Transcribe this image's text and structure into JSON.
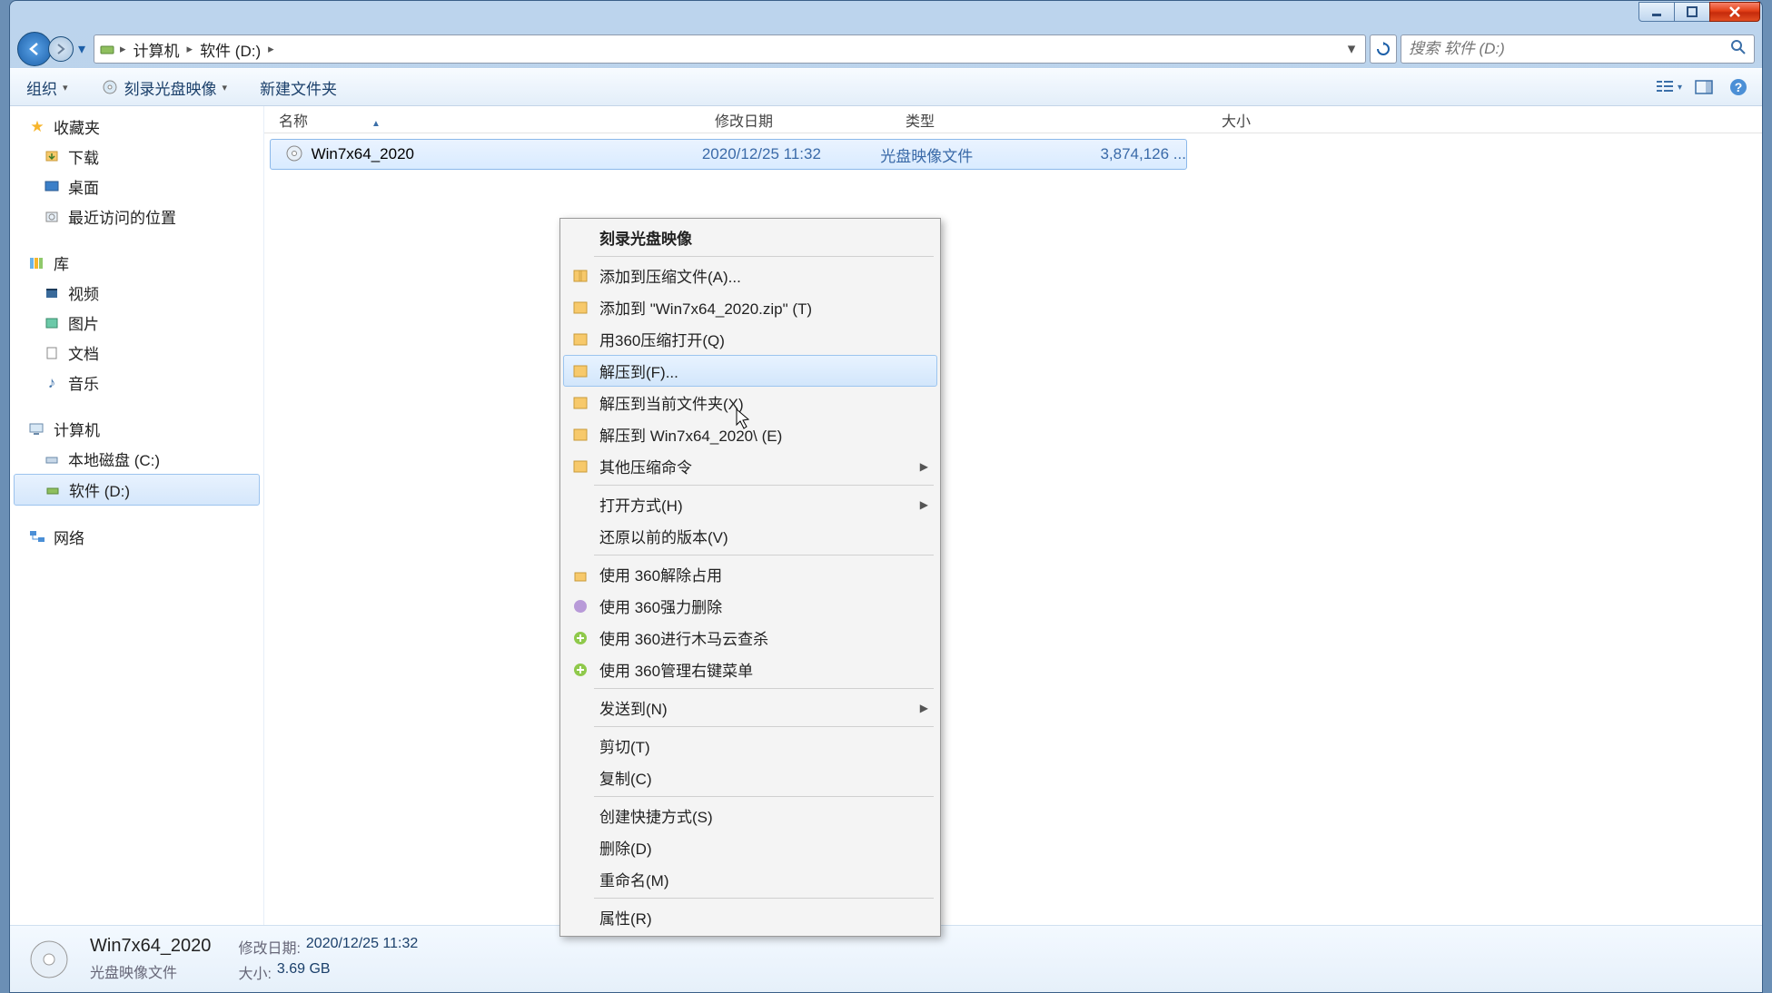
{
  "window_controls": {
    "minimize": "minimize",
    "maximize": "maximize",
    "close": "close"
  },
  "breadcrumb": {
    "root": "计算机",
    "folder": "软件 (D:)"
  },
  "search": {
    "placeholder": "搜索 软件 (D:)"
  },
  "toolbar": {
    "organize": "组织",
    "burn": "刻录光盘映像",
    "newfolder": "新建文件夹"
  },
  "columns": {
    "name": "名称",
    "date": "修改日期",
    "type": "类型",
    "size": "大小"
  },
  "sidebar": {
    "favorites": "收藏夹",
    "downloads": "下载",
    "desktop": "桌面",
    "recent": "最近访问的位置",
    "libraries": "库",
    "videos": "视频",
    "pictures": "图片",
    "documents": "文档",
    "music": "音乐",
    "computer": "计算机",
    "localdisk_c": "本地磁盘 (C:)",
    "software_d": "软件 (D:)",
    "network": "网络"
  },
  "file": {
    "name": "Win7x64_2020",
    "date": "2020/12/25 11:32",
    "type": "光盘映像文件",
    "size": "3,874,126 ..."
  },
  "context_menu": {
    "burn_image": "刻录光盘映像",
    "add_to_archive": "添加到压缩文件(A)...",
    "add_to_zip": "添加到 \"Win7x64_2020.zip\" (T)",
    "open_360zip": "用360压缩打开(Q)",
    "extract_to": "解压到(F)...",
    "extract_here": "解压到当前文件夹(X)",
    "extract_folder": "解压到 Win7x64_2020\\ (E)",
    "other_zip": "其他压缩命令",
    "open_with": "打开方式(H)",
    "restore_prev": "还原以前的版本(V)",
    "unlock_360": "使用 360解除占用",
    "force_del_360": "使用 360强力删除",
    "trojan_360": "使用 360进行木马云查杀",
    "menu_360": "使用 360管理右键菜单",
    "send_to": "发送到(N)",
    "cut": "剪切(T)",
    "copy": "复制(C)",
    "shortcut": "创建快捷方式(S)",
    "delete": "删除(D)",
    "rename": "重命名(M)",
    "properties": "属性(R)"
  },
  "details": {
    "title": "Win7x64_2020",
    "subtitle": "光盘映像文件",
    "date_k": "修改日期:",
    "date_v": "2020/12/25 11:32",
    "size_k": "大小:",
    "size_v": "3.69 GB"
  }
}
